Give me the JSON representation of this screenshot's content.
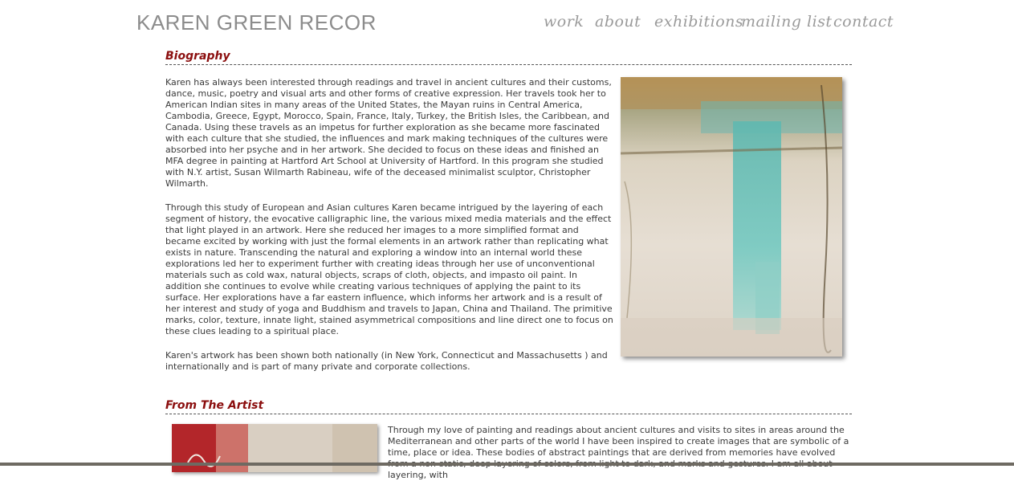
{
  "header": {
    "site_title": "KAREN GREEN RECOR",
    "nav": [
      "work",
      "about",
      "exhibitions",
      "mailing list",
      "contact"
    ]
  },
  "biography": {
    "heading": "Biography",
    "paragraphs": [
      "Karen has always been interested through readings and travel in ancient cultures and their customs, dance, music, poetry and visual arts and other forms of creative expression. Her travels took her to American Indian sites in many areas of the United States, the Mayan ruins in Central America, Cambodia, Greece, Egypt, Morocco, Spain, France, Italy, Turkey, the British Isles, the Caribbean, and Canada. Using these travels as an impetus for further exploration as she became more fascinated with each culture that she studied, the influences and mark making techniques of the cultures were absorbed into her psyche and in her artwork. She decided to focus on these ideas and finished an MFA degree in painting at Hartford Art School at University of Hartford. In this program she studied with N.Y. artist, Susan Wilmarth Rabineau, wife of the deceased minimalist sculptor, Christopher Wilmarth.",
      "Through this study of European and Asian cultures Karen became intrigued by the layering of each segment of history, the evocative calligraphic line, the various mixed media materials and the effect that light played in an artwork. Here she reduced her images to a more simplified format and became excited by working with just the formal elements in an artwork rather than replicating what exists in nature. Transcending the natural and exploring a window into an internal world these explorations led her to experiment further with creating ideas through her use of unconventional materials such as cold wax, natural objects, scraps of cloth, objects, and impasto oil paint. In addition she continues to evolve while creating various techniques of applying the paint to its surface. Her explorations have a far eastern influence, which informs her artwork and is a result of her interest and study of yoga and Buddhism and travels to Japan, China and Thailand. The primitive marks, color, texture, innate light, stained asymmetrical compositions and line direct one to focus on these clues leading to a spiritual place.",
      "Karen's artwork has been shown both nationally (in New York, Connecticut and Massachusetts ) and internationally and is part of many private and corporate collections."
    ]
  },
  "artist": {
    "heading": "From The Artist",
    "text": "Through my love of painting and readings about ancient cultures and visits to sites in areas around the Mediterranean and other parts of the world I have been inspired to create images that are symbolic of a time, place or idea. These bodies of abstract paintings that are derived from memories have evolved from a non-static, deep layering of colors, from light to dark, and marks and gestures. I am all about layering, with"
  },
  "colors": {
    "heading_red": "#8b0e0e",
    "nav_gray": "#9a9a9a",
    "title_gray": "#8c8c8c",
    "painting_turquoise": "#6fc4bd"
  }
}
